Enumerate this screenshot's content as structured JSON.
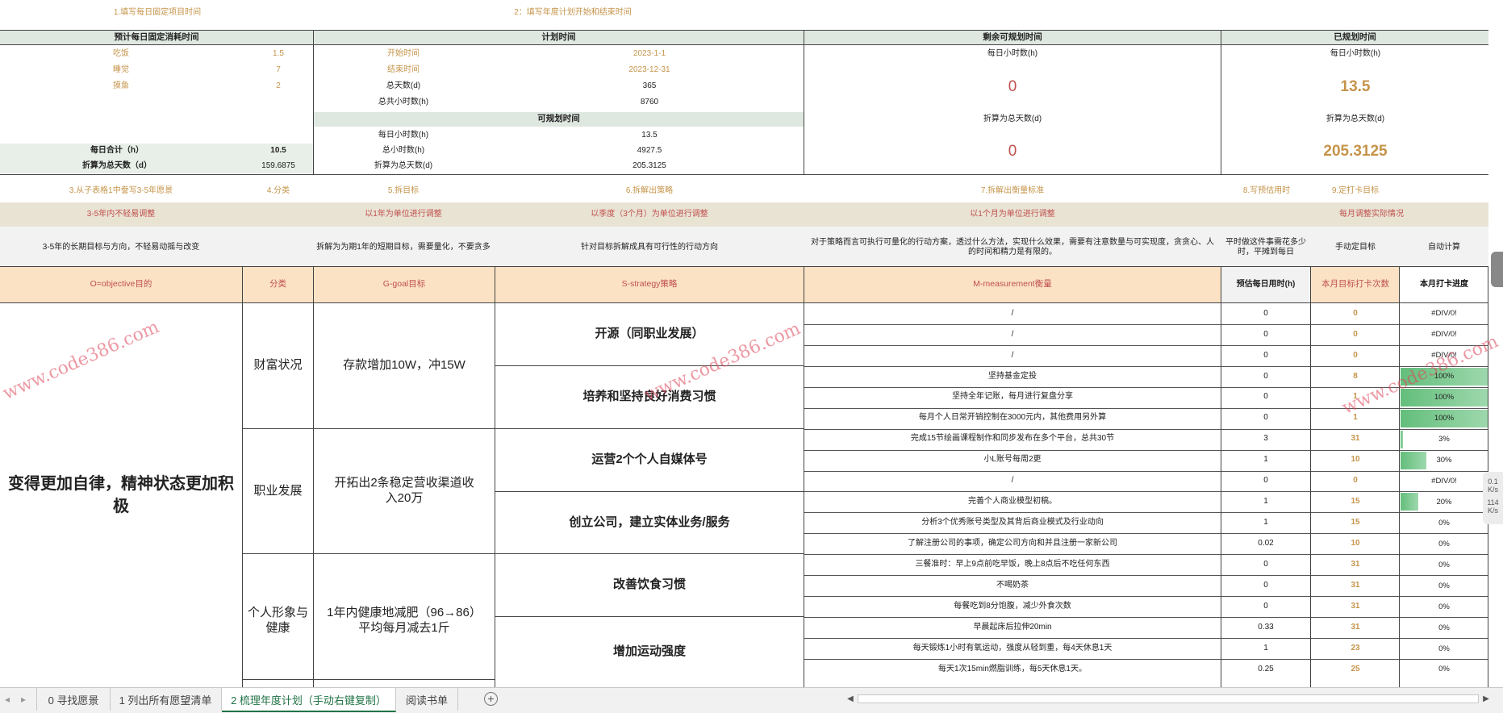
{
  "hints": {
    "h1": "1.填写每日固定项目时间",
    "h2": "2：填写年度计划开始和结束时间"
  },
  "headers": {
    "fixed": "预计每日固定消耗时间",
    "plan": "计划时间",
    "remain": "剩余可规划时间",
    "planned": "已规划时间",
    "plannable": "可规划时间"
  },
  "fixed_items": [
    {
      "name": "吃饭",
      "value": "1.5"
    },
    {
      "name": "睡觉",
      "value": "7"
    },
    {
      "name": "摸鱼",
      "value": "2"
    }
  ],
  "fixed_totals": [
    {
      "name": "每日合计（h）",
      "value": "10.5"
    },
    {
      "name": "折算为总天数（d）",
      "value": "159.6875"
    }
  ],
  "plan_rows": [
    {
      "name": "开始时间",
      "value": "2023-1-1"
    },
    {
      "name": "结束时间",
      "value": "2023-12-31"
    },
    {
      "name": "总天数(d)",
      "value": "365"
    },
    {
      "name": "总共小时数(h)",
      "value": "8760"
    }
  ],
  "plannable_rows": [
    {
      "name": "每日小时数(h)",
      "value": "13.5"
    },
    {
      "name": "总小时数(h)",
      "value": "4927.5"
    },
    {
      "name": "折算为总天数(d)",
      "value": "205.3125"
    }
  ],
  "remain": {
    "daily_label": "每日小时数(h)",
    "daily_value": "0",
    "days_label": "折算为总天数(d)",
    "days_value": "0"
  },
  "planned": {
    "daily_label": "每日小时数(h)",
    "daily_value": "13.5",
    "days_label": "折算为总天数(d)",
    "days_value": "205.3125"
  },
  "steps": {
    "s3": "3.从子表格1中誊写3-5年愿景",
    "s4": "4.分类",
    "s5": "5.拆目标",
    "s6": "6.拆解出策略",
    "s7": "7.拆解出衡量标准",
    "s8": "8.写预估用时",
    "s9": "9.定打卡目标"
  },
  "periods": {
    "p1": "3-5年内不轻易调整",
    "p2": "以1年为单位进行调整",
    "p3": "以季度（3个月）为单位进行调整",
    "p4": "以1个月为单位进行调整",
    "p5": "每月调整实际情况"
  },
  "descs": {
    "d1": "3-5年的长期目标与方向，不轻易动摇与改变",
    "d2": "拆解为为期1年的短期目标，需要量化，不要贪多",
    "d3": "针对目标拆解成具有可行性的行动方向",
    "d4": "对于策略而言可执行可量化的行动方案，透过什么方法，实现什么效果，需要有注意数量与可实现度，贪贪心、人的时间和精力是有限的。",
    "d5": "平时做这件事需花多少时，平摊到每日",
    "d6": "手动定目标",
    "d7": "自动计算"
  },
  "cols": {
    "o": "O=objective目的",
    "cat": "分类",
    "g": "G-goal目标",
    "s": "S-strategy策略",
    "m": "M-measurement衡量",
    "est": "预估每日用时(h)",
    "target": "本月目标打卡次数",
    "progress": "本月打卡进度"
  },
  "objective": "变得更加自律，精神状态更加积极",
  "categories": [
    "财富状况",
    "职业发展",
    "个人形象与健康"
  ],
  "goals": [
    "存款增加10W，冲15W",
    "开拓出2条稳定营收渠道收入20万",
    "1年内健康地减肥（96→86）平均每月减去1斤"
  ],
  "strategies": [
    "开源（同职业发展）",
    "培养和坚持良好消费习惯",
    "运营2个个人自媒体号",
    "创立公司，建立实体业务/服务",
    "改善饮食习惯",
    "增加运动强度"
  ],
  "rows": [
    {
      "m": "/",
      "est": "0",
      "target": "0",
      "progress": "#DIV/0!",
      "pct": 0
    },
    {
      "m": "/",
      "est": "0",
      "target": "0",
      "progress": "#DIV/0!",
      "pct": 0
    },
    {
      "m": "/",
      "est": "0",
      "target": "0",
      "progress": "#DIV/0!",
      "pct": 0
    },
    {
      "m": "坚持基金定投",
      "est": "0",
      "target": "8",
      "progress": "100%",
      "pct": 1
    },
    {
      "m": "坚持全年记账，每月进行复盘分享",
      "est": "0",
      "target": "1",
      "progress": "100%",
      "pct": 1
    },
    {
      "m": "每月个人日常开销控制在3000元内，其他费用另外算",
      "est": "0",
      "target": "1",
      "progress": "100%",
      "pct": 1
    },
    {
      "m": "完成15节绘画课程制作和同步发布在多个平台，总共30节",
      "est": "3",
      "target": "31",
      "progress": "3%",
      "pct": 0.03
    },
    {
      "m": "小L账号每周2更",
      "est": "1",
      "target": "10",
      "progress": "30%",
      "pct": 0.3
    },
    {
      "m": "/",
      "est": "0",
      "target": "0",
      "progress": "#DIV/0!",
      "pct": 0
    },
    {
      "m": "完善个人商业模型初稿。",
      "est": "1",
      "target": "15",
      "progress": "20%",
      "pct": 0.2
    },
    {
      "m": "分析3个优秀账号类型及其背后商业模式及行业动向",
      "est": "1",
      "target": "15",
      "progress": "0%",
      "pct": 0
    },
    {
      "m": "了解注册公司的事项，确定公司方向和并且注册一家新公司",
      "est": "0.02",
      "target": "10",
      "progress": "0%",
      "pct": 0
    },
    {
      "m": "三餐准时：早上9点前吃早饭，晚上8点后不吃任何东西",
      "est": "0",
      "target": "31",
      "progress": "0%",
      "pct": 0
    },
    {
      "m": "不喝奶茶",
      "est": "0",
      "target": "31",
      "progress": "0%",
      "pct": 0
    },
    {
      "m": "每餐吃到8分饱腹，减少外食次数",
      "est": "0",
      "target": "31",
      "progress": "0%",
      "pct": 0
    },
    {
      "m": "早晨起床后拉伸20min",
      "est": "0.33",
      "target": "31",
      "progress": "0%",
      "pct": 0
    },
    {
      "m": "每天锻炼1小时有氧运动，强度从轻到重，每4天休息1天",
      "est": "1",
      "target": "23",
      "progress": "0%",
      "pct": 0
    },
    {
      "m": "每天1次15min燃脂训练，每5天休息1天。",
      "est": "0.25",
      "target": "25",
      "progress": "0%",
      "pct": 0
    }
  ],
  "tabs": [
    "0 寻找愿景",
    "1 列出所有愿望清单",
    "2 梳理年度计划（手动右键复制）",
    "阅读书单"
  ],
  "watermark": "www.code386.com",
  "side": {
    "a": "0.1",
    "a_unit": "K/s",
    "b": "114",
    "b_unit": "K/s"
  }
}
